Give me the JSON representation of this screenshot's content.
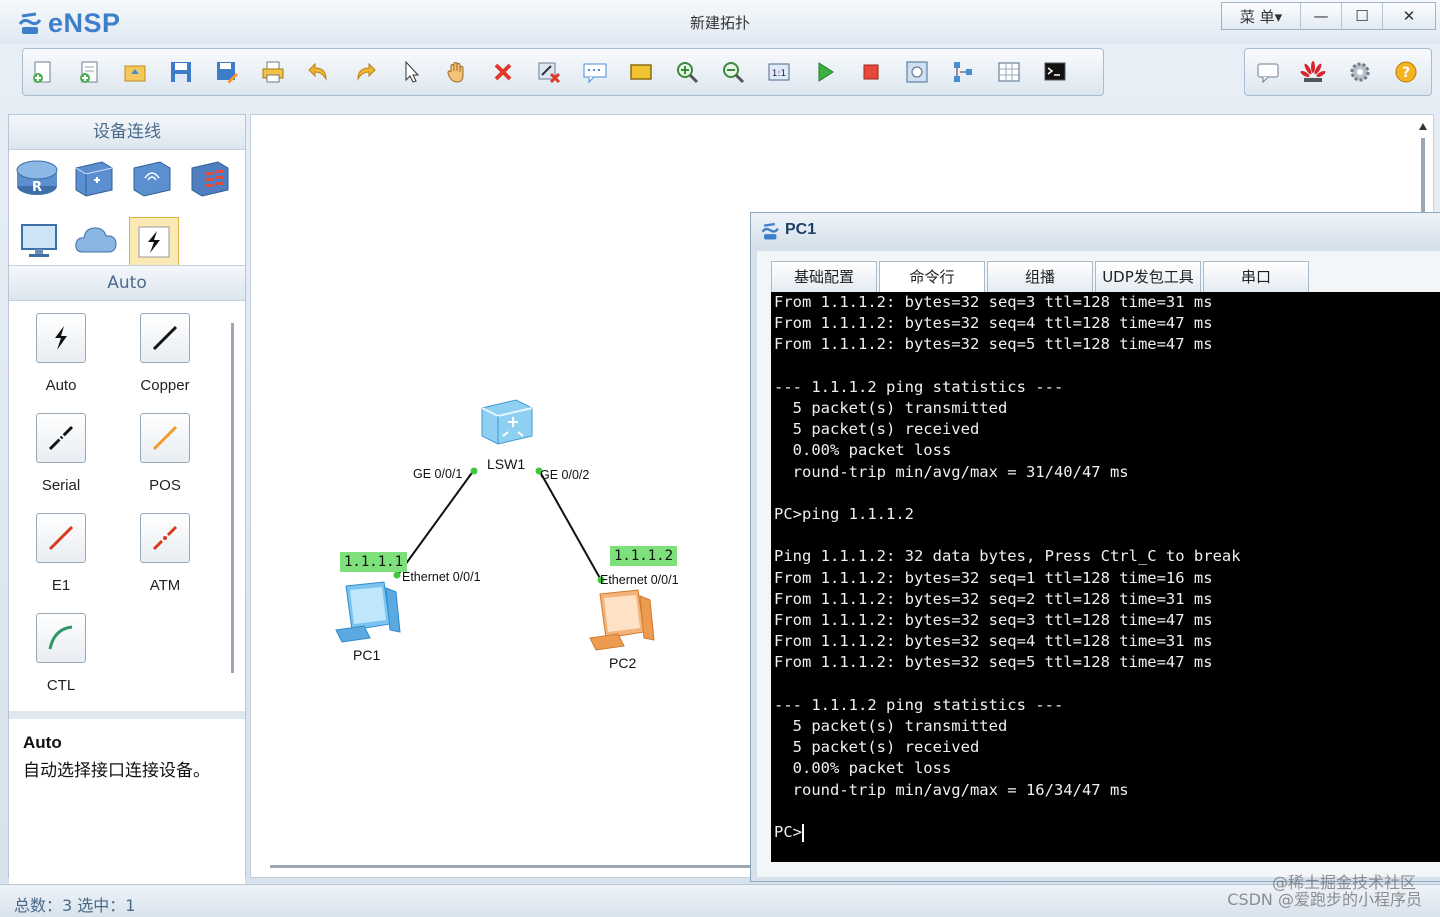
{
  "app": {
    "logo_text": "eNSP",
    "window_title": "新建拓扑",
    "menu_label": "菜 单▾",
    "minimize": "—",
    "maximize": "☐",
    "close": "✕"
  },
  "toolbar": {
    "buttons": [
      "new-topology",
      "new-lab",
      "open",
      "save",
      "save-as",
      "print",
      "undo",
      "redo",
      "select",
      "pan",
      "delete",
      "delete-all-links",
      "text",
      "palette",
      "zoom-in",
      "zoom-out",
      "fit",
      "start-device",
      "stop-device",
      "capture",
      "topology",
      "grid",
      "terminal"
    ],
    "right_buttons": [
      "forum",
      "huawei",
      "settings",
      "help"
    ]
  },
  "left_panel": {
    "header": "设备连线",
    "devices": [
      "router",
      "switch",
      "wireless",
      "firewall",
      "pc",
      "cloud",
      "auto-cable"
    ],
    "sub_header": "Auto",
    "cables": [
      {
        "label": "Auto",
        "color": "#111111"
      },
      {
        "label": "Copper",
        "color": "#111111"
      },
      {
        "label": "Serial",
        "color": "#111111"
      },
      {
        "label": "POS",
        "color": "#f39a2a"
      },
      {
        "label": "E1",
        "color": "#d9381e"
      },
      {
        "label": "ATM",
        "color": "#d9381e"
      },
      {
        "label": "CTL",
        "color": "#2e9a6a"
      }
    ],
    "desc_title": "Auto",
    "desc_text": "自动选择接口连接设备。"
  },
  "topology": {
    "switch": {
      "name": "LSW1",
      "port1": "GE 0/0/1",
      "port2": "GE 0/0/2"
    },
    "pc1": {
      "name": "PC1",
      "port": "Ethernet 0/0/1",
      "ip": "1.1.1.1"
    },
    "pc2": {
      "name": "PC2",
      "port": "Ethernet 0/0/1",
      "ip": "1.1.1.2"
    }
  },
  "pc1_window": {
    "title": "PC1",
    "tabs": [
      "基础配置",
      "命令行",
      "组播",
      "UDP发包工具",
      "串口"
    ],
    "console_lines": [
      "From 1.1.1.2: bytes=32 seq=3 ttl=128 time=31 ms",
      "From 1.1.1.2: bytes=32 seq=4 ttl=128 time=47 ms",
      "From 1.1.1.2: bytes=32 seq=5 ttl=128 time=47 ms",
      "",
      "--- 1.1.1.2 ping statistics ---",
      "  5 packet(s) transmitted",
      "  5 packet(s) received",
      "  0.00% packet loss",
      "  round-trip min/avg/max = 31/40/47 ms",
      "",
      "PC>ping 1.1.1.2",
      "",
      "Ping 1.1.1.2: 32 data bytes, Press Ctrl_C to break",
      "From 1.1.1.2: bytes=32 seq=1 ttl=128 time=16 ms",
      "From 1.1.1.2: bytes=32 seq=2 ttl=128 time=31 ms",
      "From 1.1.1.2: bytes=32 seq=3 ttl=128 time=47 ms",
      "From 1.1.1.2: bytes=32 seq=4 ttl=128 time=31 ms",
      "From 1.1.1.2: bytes=32 seq=5 ttl=128 time=47 ms",
      "",
      "--- 1.1.1.2 ping statistics ---",
      "  5 packet(s) transmitted",
      "  5 packet(s) received",
      "  0.00% packet loss",
      "  round-trip min/avg/max = 16/34/47 ms",
      ""
    ],
    "prompt": "PC>"
  },
  "statusbar": {
    "text": "总数：3  选中：1",
    "watermark1": "@稀土掘金技术社区",
    "watermark2": "CSDN @爱跑步的小程序员"
  }
}
